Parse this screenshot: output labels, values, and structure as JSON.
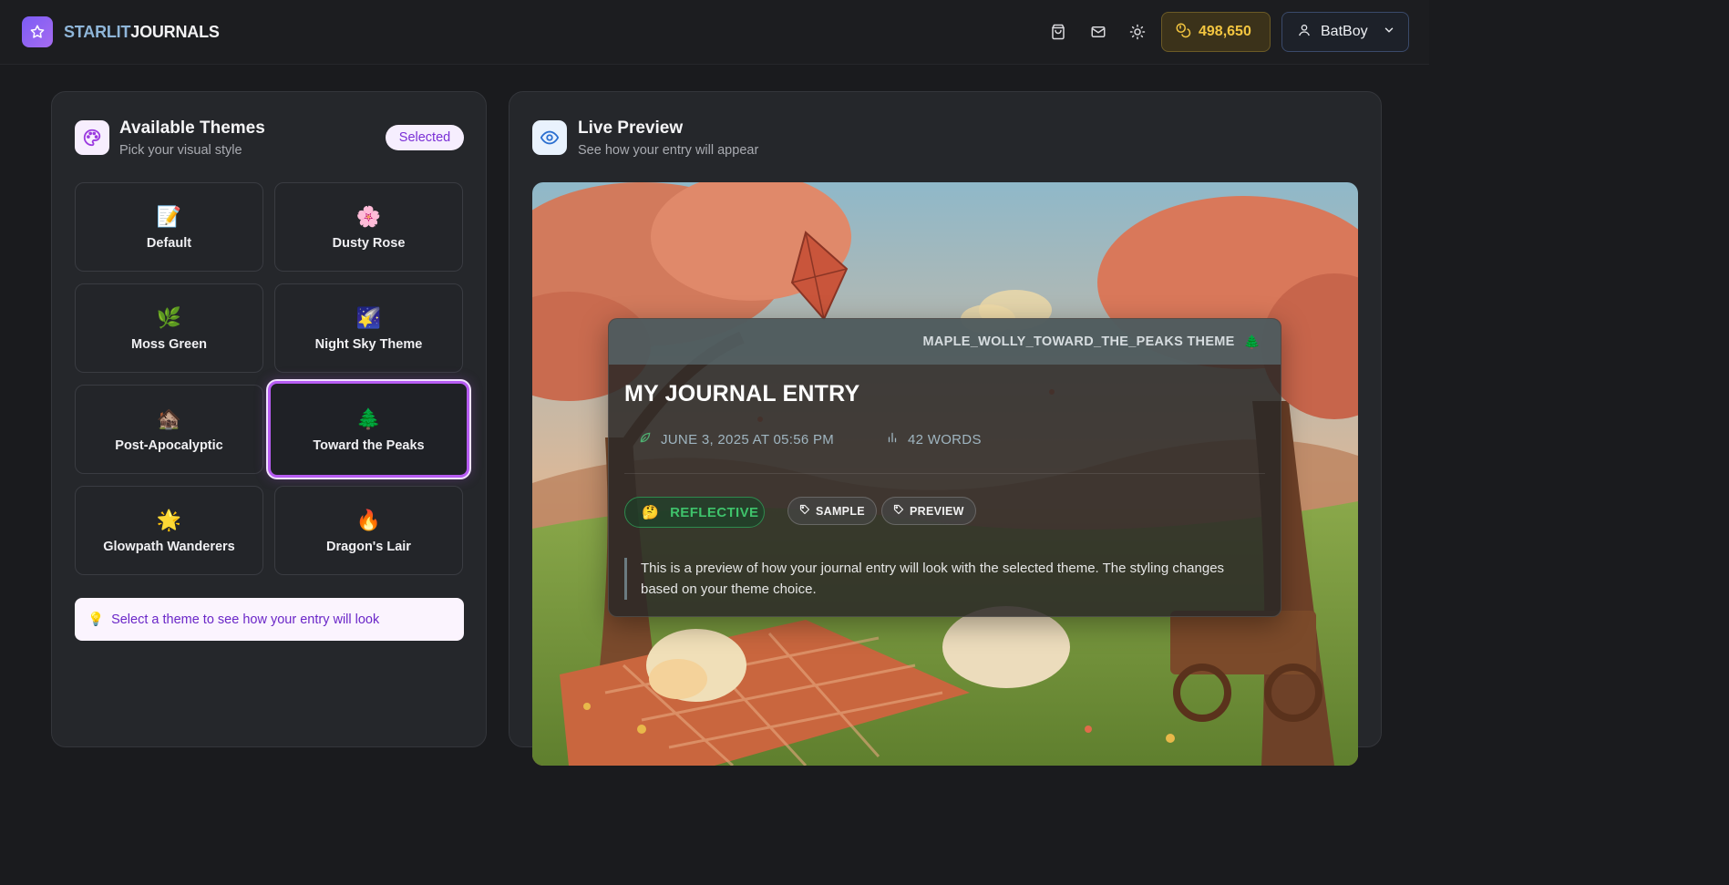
{
  "header": {
    "brand_part1": "STARLIT",
    "brand_part2": "JOURNALS",
    "coins": "498,650",
    "username": "BatBoy",
    "icons": [
      "shopping-bag-icon",
      "mail-icon",
      "sun-icon"
    ]
  },
  "themes_panel": {
    "title": "Available Themes",
    "subtitle": "Pick your visual style",
    "badge": "Selected",
    "themes": [
      {
        "label": "Default",
        "emoji": "📝"
      },
      {
        "label": "Dusty Rose",
        "emoji": "🌸"
      },
      {
        "label": "Moss Green",
        "emoji": "🌿"
      },
      {
        "label": "Night Sky Theme",
        "emoji": "🌠"
      },
      {
        "label": "Post-Apocalyptic",
        "emoji": "🏚️"
      },
      {
        "label": "Toward the Peaks",
        "emoji": "🌲"
      },
      {
        "label": "Glowpath Wanderers",
        "emoji": "🌟"
      },
      {
        "label": "Dragon's Lair",
        "emoji": "🔥"
      }
    ],
    "selected_theme": "Toward the Peaks",
    "tip_icon": "💡",
    "tip": "Select a theme to see how your entry will look"
  },
  "preview_panel": {
    "title": "Live Preview",
    "subtitle": "See how your entry will appear",
    "entry": {
      "theme_label": "MAPLE_WOLLY_TOWARD_THE_PEAKS THEME",
      "theme_emoji": "🌲",
      "title": "MY JOURNAL ENTRY",
      "date": "JUNE 3, 2025 AT 05:56 PM",
      "words": "42 WORDS",
      "mood": "REFLECTIVE",
      "mood_emoji": "🤔",
      "tags": [
        "SAMPLE",
        "PREVIEW"
      ],
      "body": "This is a preview of how your journal entry will look with the selected theme. The styling changes based on your theme choice."
    }
  },
  "colors": {
    "accent_purple": "#b65cf2",
    "coin_gold": "#f4c640",
    "mood_green": "#3fc26b"
  }
}
